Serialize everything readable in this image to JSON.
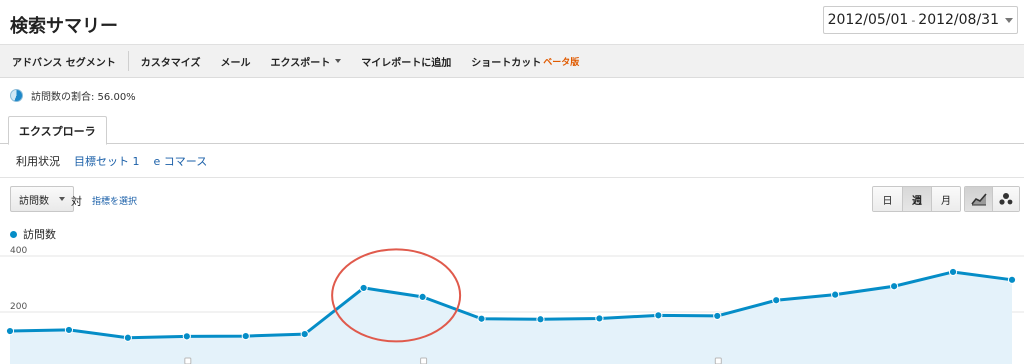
{
  "header": {
    "title": "検索サマリー",
    "date_start": "2012/05/01",
    "date_sep": "-",
    "date_end": "2012/08/31"
  },
  "toolbar": {
    "items": [
      {
        "label": "アドバンス セグメント"
      },
      {
        "label": "カスタマイズ"
      },
      {
        "label": "メール"
      },
      {
        "label": "エクスポート"
      },
      {
        "label": "マイレポートに追加"
      },
      {
        "label": "ショートカット"
      }
    ],
    "beta_label": "ベータ版"
  },
  "segment": {
    "label": "訪問数の割合: 56.00%",
    "percent": 56.0
  },
  "tabs": {
    "active": "エクスプローラ"
  },
  "subnav": {
    "items": [
      {
        "label": "利用状況"
      },
      {
        "label": "目標セット 1"
      },
      {
        "label": "e コマース"
      }
    ]
  },
  "controls": {
    "metric": "訪問数",
    "vs": "対",
    "pick_metric": "指標を選択",
    "periods": [
      {
        "label": "日"
      },
      {
        "label": "週"
      },
      {
        "label": "月"
      }
    ],
    "active_period": "週"
  },
  "legend": {
    "series_name": "訪問数"
  },
  "colors": {
    "series": "#058dc7",
    "fill": "#e4f2fa",
    "highlight": "#e05a4c",
    "link": "#1a5fa8",
    "beta": "#e05a00"
  },
  "chart_data": {
    "type": "area",
    "series": [
      {
        "name": "訪問数",
        "values": [
          132,
          136,
          108,
          113,
          114,
          121,
          286,
          254,
          176,
          174,
          177,
          188,
          186,
          242,
          262,
          292,
          343,
          315
        ]
      }
    ],
    "y_ticks": [
      400,
      200
    ],
    "ylim": [
      100,
      430
    ],
    "grid": true,
    "highlight": {
      "shape": "ellipse",
      "around_points": [
        6,
        7
      ]
    }
  }
}
